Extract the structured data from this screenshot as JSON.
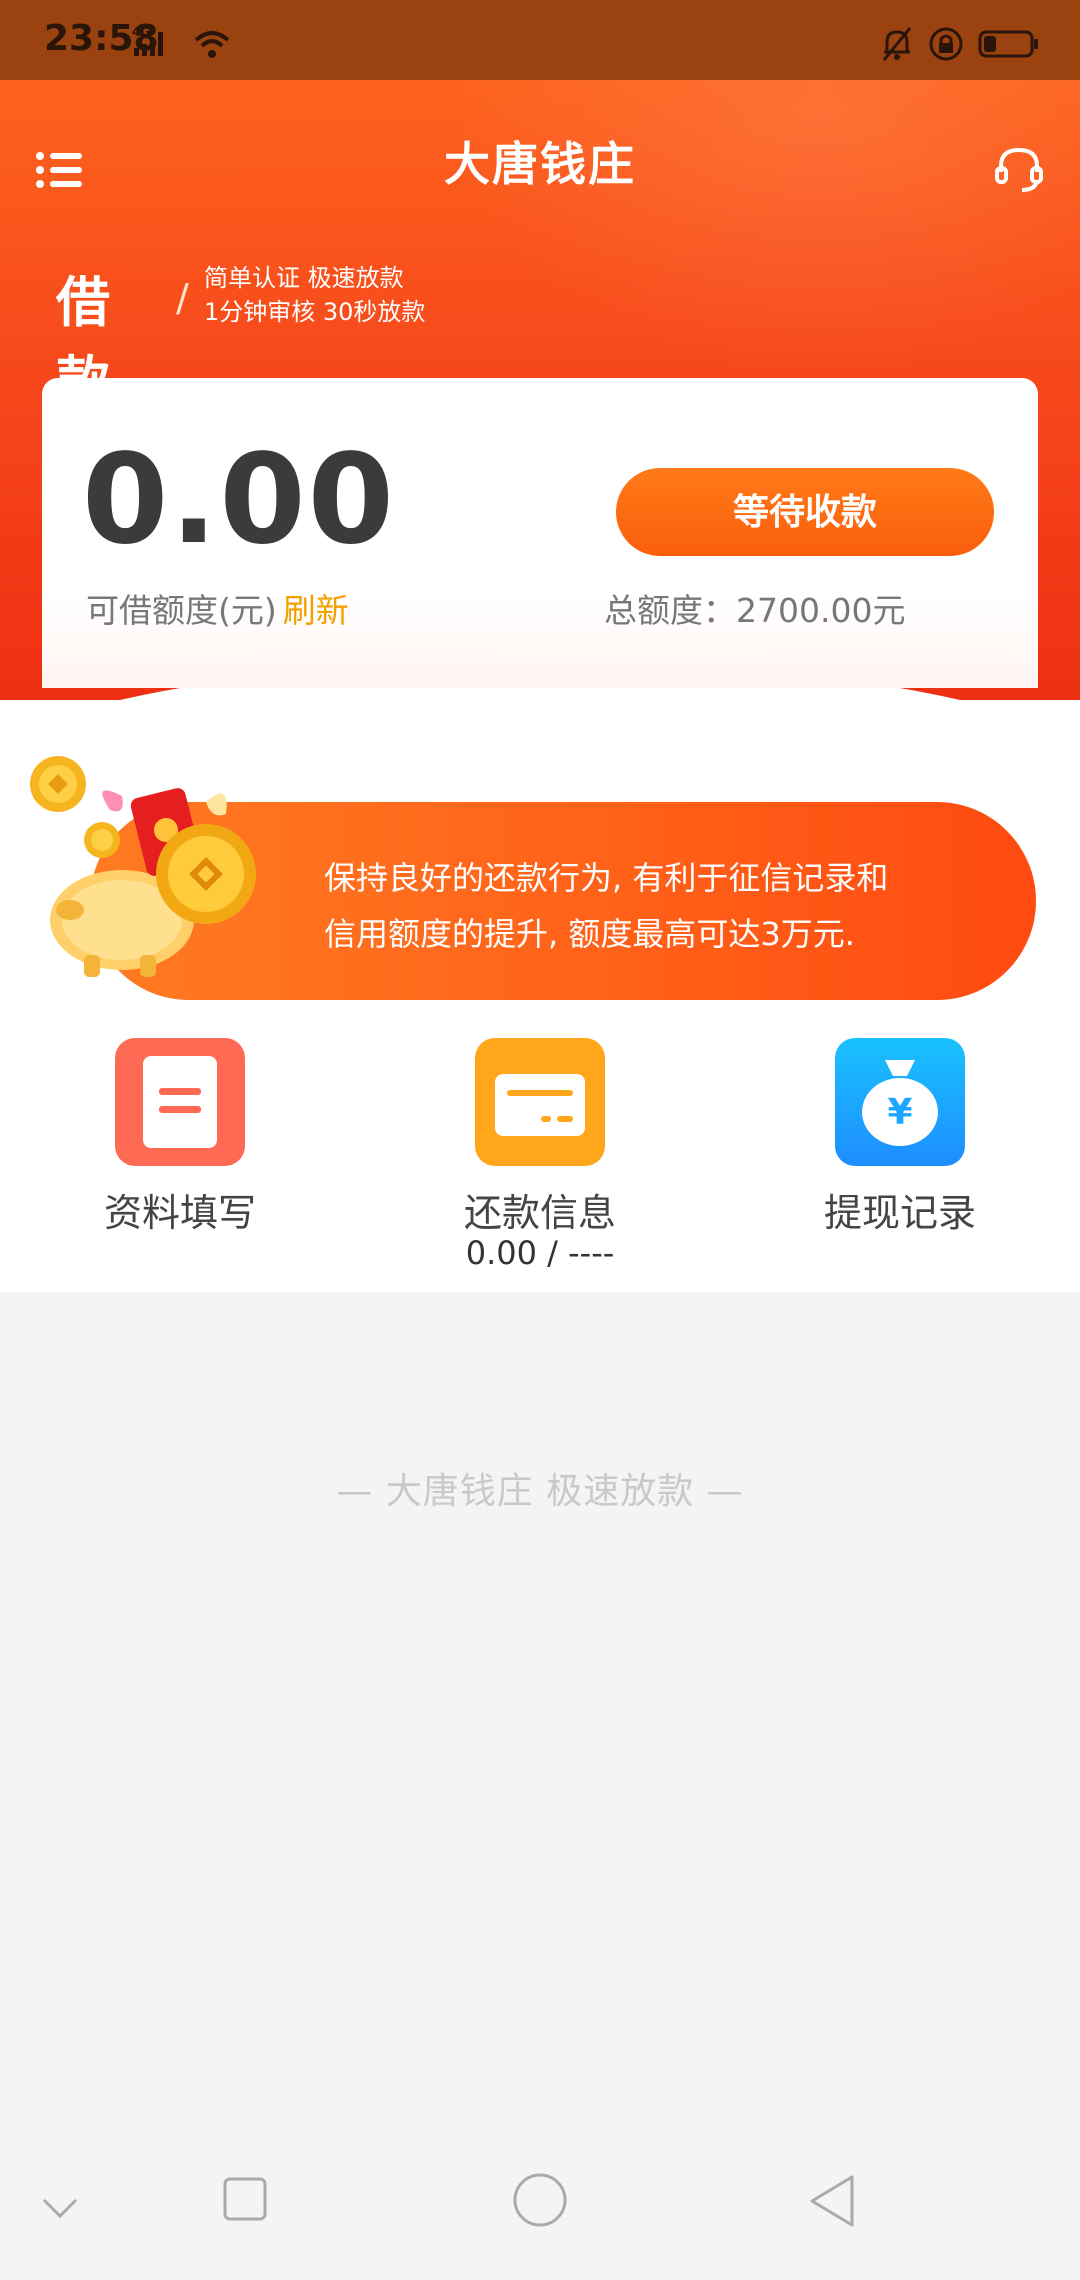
{
  "status_bar": {
    "time": "23:58",
    "network": "4G"
  },
  "app": {
    "title": "大唐钱庄"
  },
  "loan_header": {
    "title": "借款",
    "slash": "/",
    "subtitle_line1": "简单认证  极速放款",
    "subtitle_line2": "1分钟审核  30秒放款"
  },
  "credit": {
    "amount": "0.00",
    "amount_label": "可借额度(元)",
    "refresh_label": "刷新",
    "action_label": "等待收款",
    "total_label": "总额度：2700.00元"
  },
  "promo": {
    "line1": "保持良好的还款行为, 有利于征信记录和",
    "line2": "信用额度的提升, 额度最高可达3万元."
  },
  "features": [
    {
      "label": "资料填写",
      "sub": "",
      "icon": "form-icon",
      "color": "#ff6a55"
    },
    {
      "label": "还款信息",
      "sub": "0.00 / ----",
      "icon": "card-icon",
      "color": "#ffa61a"
    },
    {
      "label": "提现记录",
      "sub": "",
      "icon": "money-bag-icon",
      "color": "#1aa8ff"
    }
  ],
  "slogan": "—  大唐钱庄   极速放款  —",
  "colors": {
    "brand_orange": "#ff6a1e",
    "brand_red": "#ee2f12",
    "button_orange": "#fa5e0c",
    "refresh_gold": "#f2a100"
  }
}
